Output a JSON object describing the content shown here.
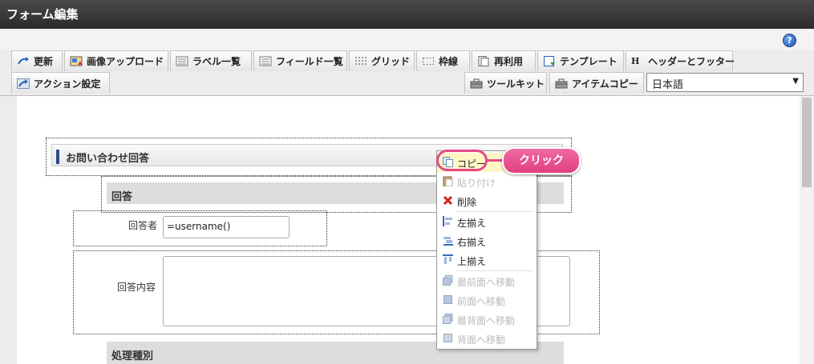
{
  "window": {
    "title": "フォーム編集"
  },
  "toolbar": {
    "help_icon": "?",
    "row1": [
      {
        "label": "更新",
        "icon": "refresh-icon"
      },
      {
        "label": "画像アップロード",
        "icon": "image-upload-icon"
      },
      {
        "label": "ラベル一覧",
        "icon": "label-list-icon"
      },
      {
        "label": "フィールド一覧",
        "icon": "field-list-icon"
      },
      {
        "label": "グリッド",
        "icon": "grid-icon"
      },
      {
        "label": "枠線",
        "icon": "border-icon"
      },
      {
        "label": "再利用",
        "icon": "reuse-icon"
      },
      {
        "label": "テンプレート",
        "icon": "template-icon"
      },
      {
        "label": "ヘッダーとフッター",
        "icon": "header-footer-icon"
      }
    ],
    "action_label": "アクション設定",
    "toolkit_label": "ツールキット",
    "item_copy_label": "アイテムコピー",
    "language": {
      "selected": "日本語"
    }
  },
  "form": {
    "heading": "お問い合わせ回答",
    "section1": "回答",
    "responder_label": "回答者",
    "responder_value": "=username()",
    "content_label": "回答内容",
    "content_value": "",
    "section2": "処理種別"
  },
  "context_menu": {
    "items": [
      {
        "label": "コピー",
        "enabled": true,
        "icon": "copy-icon"
      },
      {
        "label": "貼り付け",
        "enabled": false,
        "icon": "paste-icon"
      },
      {
        "label": "削除",
        "enabled": true,
        "icon": "delete-icon"
      },
      {
        "label": "左揃え",
        "enabled": true,
        "icon": "align-left-icon"
      },
      {
        "label": "右揃え",
        "enabled": true,
        "icon": "align-right-icon"
      },
      {
        "label": "上揃え",
        "enabled": true,
        "icon": "align-top-icon"
      },
      {
        "label": "最前面へ移動",
        "enabled": false,
        "icon": "bring-to-front-icon"
      },
      {
        "label": "前面へ移動",
        "enabled": false,
        "icon": "bring-forward-icon"
      },
      {
        "label": "最背面へ移動",
        "enabled": false,
        "icon": "send-to-back-icon"
      },
      {
        "label": "背面へ移動",
        "enabled": false,
        "icon": "send-backward-icon"
      }
    ]
  },
  "annotation": {
    "label": "クリック"
  },
  "colors": {
    "accent": "#e6488a",
    "titlebar": "#333333",
    "heading_bar": "#2e4a8a"
  }
}
